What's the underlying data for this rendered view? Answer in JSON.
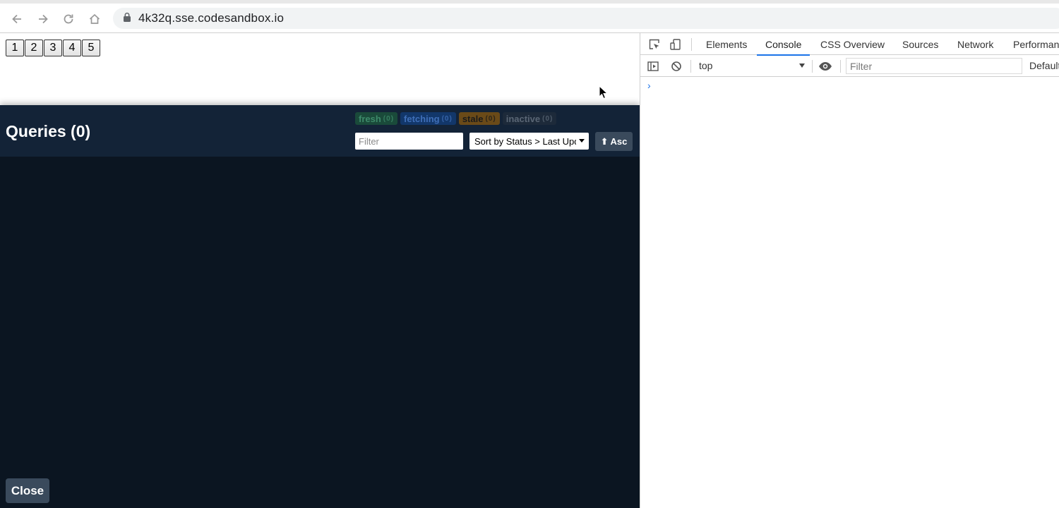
{
  "browser": {
    "url": "4k32q.sse.codesandbox.io",
    "nav": {
      "back": "back-icon",
      "forward": "forward-icon",
      "reload": "reload-icon",
      "home": "home-icon"
    }
  },
  "page": {
    "buttons": [
      "1",
      "2",
      "3",
      "4",
      "5"
    ]
  },
  "devtools_panel": {
    "title": "Queries (0)",
    "badges": [
      {
        "label": "fresh",
        "count": "(0)"
      },
      {
        "label": "fetching",
        "count": "(0)"
      },
      {
        "label": "stale",
        "count": "(0)"
      },
      {
        "label": "inactive",
        "count": "(0)"
      }
    ],
    "filter_placeholder": "Filter",
    "sort_label": "Sort by Status > Last Updated",
    "order_button": "Asc",
    "order_icon": "⬆",
    "close_button": "Close",
    "colors": {
      "background": "#0b1521",
      "header": "#132337",
      "button": "#3a4a5c"
    }
  },
  "chrome_devtools": {
    "tabs": [
      "Elements",
      "Console",
      "CSS Overview",
      "Sources",
      "Network",
      "Performance"
    ],
    "active_tab": "Console",
    "context": "top",
    "filter_placeholder": "Filter",
    "levels": "Default levels",
    "prompt": "›",
    "accent": "#1a73e8"
  }
}
